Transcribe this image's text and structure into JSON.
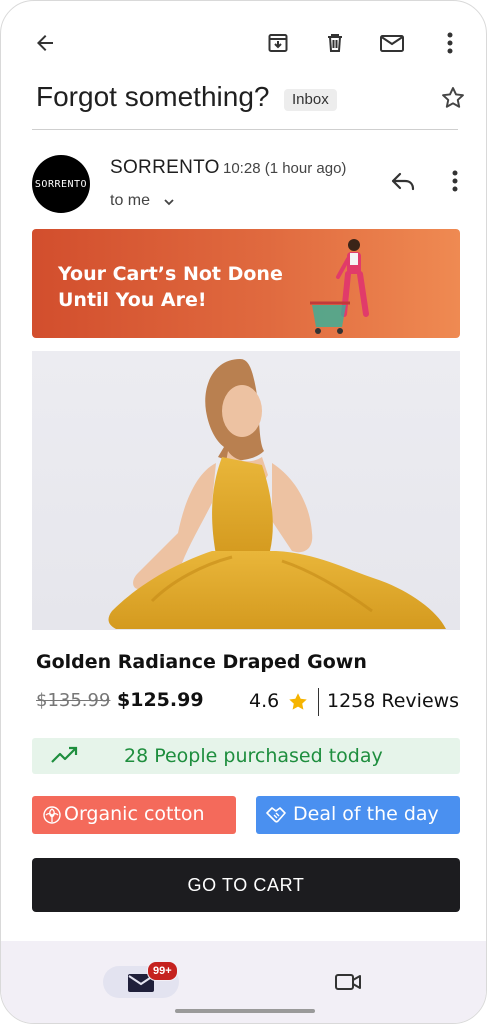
{
  "toolbar": {
    "back_icon": "back-arrow-icon",
    "archive_icon": "archive-icon",
    "delete_icon": "trash-icon",
    "mark_unread_icon": "mail-icon",
    "more_icon": "more-vert-icon"
  },
  "email": {
    "subject": "Forgot something?",
    "label_chip": "Inbox",
    "starred": false,
    "sender": {
      "avatar_text": "SORRENTO",
      "name": "SORRENTO",
      "time": "10:28 (1 hour ago)",
      "recipient": "to me"
    }
  },
  "content": {
    "banner": {
      "line1": "Your Cart’s Not Done",
      "line2": "Until You Are!",
      "bg_color": "#d9572f"
    },
    "product": {
      "name": "Golden Radiance Draped Gown",
      "old_price": "$135.99",
      "price": "$125.99",
      "rating": "4.6",
      "reviews": "1258 Reviews"
    },
    "purchased_notice": "28 People purchased today",
    "chips": {
      "organic": "Organic cotton",
      "deal": "Deal of the day"
    },
    "cta_label": "GO TO CART"
  },
  "bottom_nav": {
    "mail_badge": "99+",
    "mail_icon": "mail-icon",
    "video_icon": "video-icon"
  },
  "colors": {
    "cta": "#1c1c1f",
    "green_text": "#1e8e3e",
    "green_bg": "#e6f4ea",
    "organic_chip": "#f46a5b",
    "deal_chip": "#4a90f0",
    "star": "#f6b400",
    "badge": "#c5221f"
  }
}
